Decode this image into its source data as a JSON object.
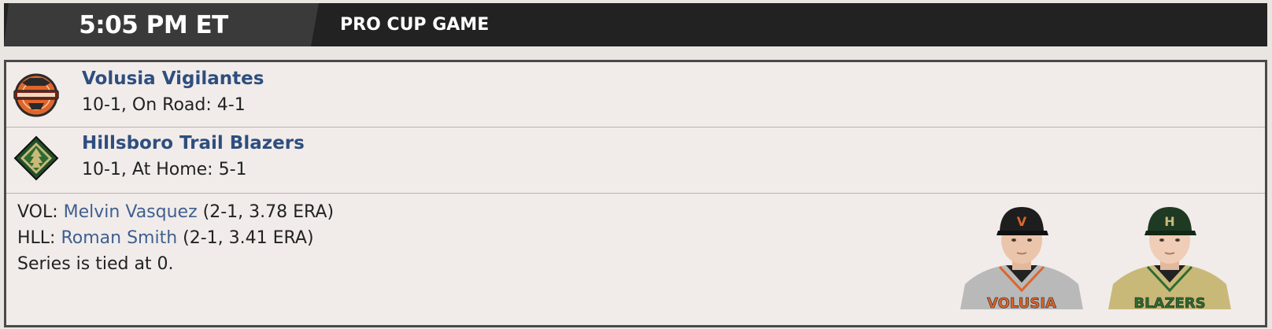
{
  "header": {
    "time": "5:05 PM ET",
    "title": "PRO CUP GAME"
  },
  "away": {
    "name": "Volusia Vigilantes",
    "record": "10-1, On Road: 4-1",
    "logo_icon": "volusia-vigilantes-logo",
    "colors": {
      "primary": "#e0652a",
      "secondary": "#1f1f1f"
    }
  },
  "home": {
    "name": "Hillsboro Trail Blazers",
    "record": "10-1, At Home: 5-1",
    "logo_icon": "hillsboro-trail-blazers-logo",
    "colors": {
      "primary": "#2e6b33",
      "secondary": "#c9b979"
    }
  },
  "matchup": {
    "away_abbr": "VOL:",
    "away_pitcher": "Melvin Vasquez",
    "away_stats": "(2-1, 3.78 ERA)",
    "home_abbr": "HLL:",
    "home_pitcher": "Roman Smith",
    "home_stats": "(2-1, 3.41 ERA)",
    "series": "Series is tied at 0."
  },
  "player_images": {
    "away_cap_letter": "V",
    "away_jersey_text": "VOLUSIA",
    "home_cap_letter": "H",
    "home_jersey_text": "BLAZERS"
  }
}
